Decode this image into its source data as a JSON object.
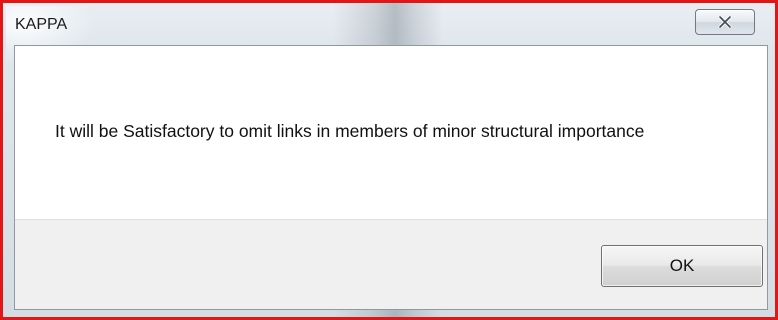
{
  "window": {
    "title": "KAPPA",
    "close_icon": "close-icon"
  },
  "dialog": {
    "message": "It will be Satisfactory to omit links in members of minor structural importance",
    "ok_label": "OK"
  },
  "colors": {
    "frame_border": "#e11717",
    "client_background": "#ffffff",
    "button_bar_background": "#f0f0f0"
  }
}
